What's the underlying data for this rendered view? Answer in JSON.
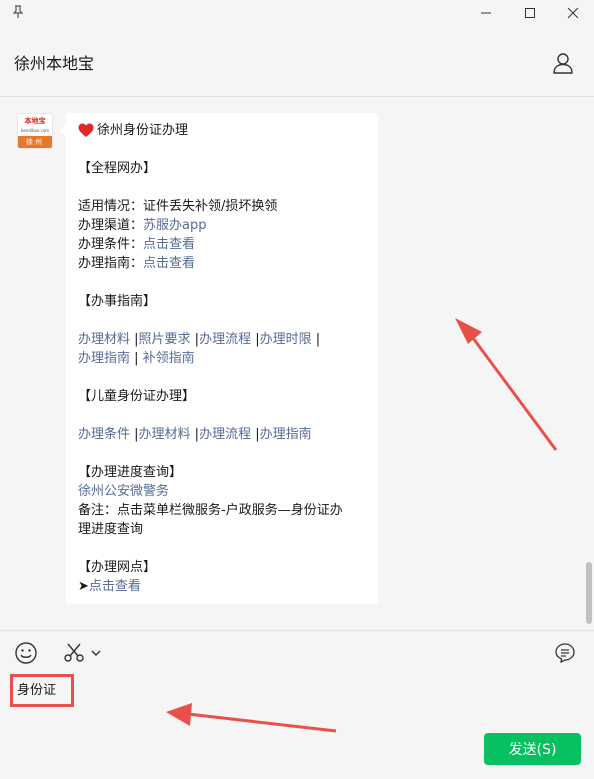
{
  "window": {
    "pin_icon": "pin-icon",
    "min_icon": "minimize-icon",
    "max_icon": "maximize-icon",
    "close_icon": "close-icon"
  },
  "header": {
    "title": "徐州本地宝",
    "profile_icon": "user-icon"
  },
  "message": {
    "avatar": {
      "top_text": "本地宝",
      "sub_text": "bendibao.com",
      "bottom_text": "徐州"
    },
    "title": "徐州身份证办理",
    "section1": "【全程网办】",
    "applicable_label": "适用情况：",
    "applicable_value": "证件丢失补领/损坏换领",
    "channel_label": "办理渠道：",
    "channel_link": "苏服办app",
    "condition_label": "办理条件：",
    "condition_link": "点击查看",
    "guide_label": "办理指南：",
    "guide_link": "点击查看",
    "section2": "【办事指南】",
    "guide_links_row1": [
      "办理材料",
      "照片要求",
      "办理流程",
      "办理时限"
    ],
    "guide_links_row2": [
      "办理指南",
      "补领指南"
    ],
    "section3": "【儿童身份证办理】",
    "child_links": [
      "办理条件",
      "办理材料",
      "办理流程",
      "办理指南"
    ],
    "section4": "【办理进度查询】",
    "progress_link": "徐州公安微警务",
    "note_line1": "备注：点击菜单栏微服务-户政服务—身份证办",
    "note_line2": "理进度查询",
    "section5": "【办理网点】",
    "outlet_prefix": "➤",
    "outlet_link": "点击查看"
  },
  "toolbar": {
    "emoji_icon": "emoji-icon",
    "scissors_icon": "scissors-icon",
    "dropdown_icon": "chevron-down-icon",
    "chat_history_icon": "chat-bubble-icon"
  },
  "input": {
    "value": "身份证"
  },
  "send_button": {
    "label": "发送(S)"
  },
  "colors": {
    "link": "#576b95",
    "send": "#07c160",
    "highlight": "#e8514a"
  }
}
